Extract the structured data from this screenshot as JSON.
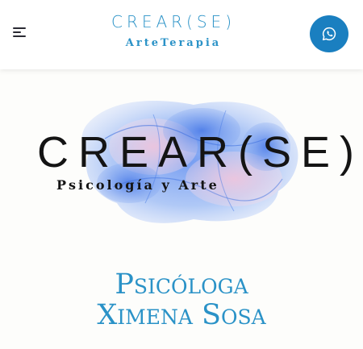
{
  "header": {
    "brand_title": "CREAR(SE)",
    "brand_subtitle": "ArteTerapia"
  },
  "hero": {
    "logo_title": "CREAR(SE)",
    "logo_subtitle": "Psicología y Arte"
  },
  "main": {
    "heading_line1": "Psicóloga",
    "heading_line2": "Ximena Sosa"
  },
  "colors": {
    "accent": "#2a92c7",
    "whatsapp_button": "#1a7fc0"
  },
  "icons": {
    "menu": "menu-icon",
    "whatsapp": "whatsapp-icon"
  }
}
